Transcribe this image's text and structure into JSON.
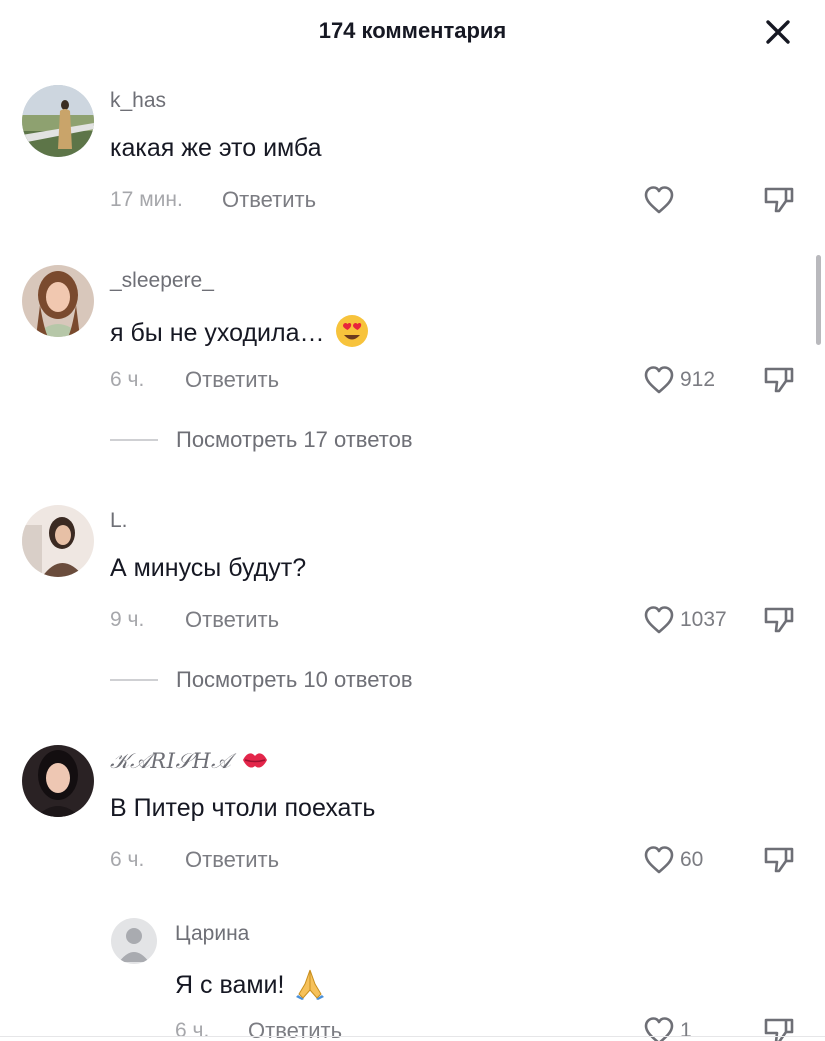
{
  "header": {
    "title": "174 комментария"
  },
  "comments": [
    {
      "username": "k_has",
      "text": "какая же это имба",
      "time": "17 мин.",
      "reply_label": "Ответить",
      "likes": "",
      "avatar_icon": "photo-avatar"
    },
    {
      "username": "_sleepere_",
      "text": "я бы не уходила…",
      "emoji": "heart-eyes-emoji",
      "time": "6 ч.",
      "reply_label": "Ответить",
      "likes": "912",
      "view_replies": "Посмотреть 17 ответов",
      "avatar_icon": "photo-avatar"
    },
    {
      "username": "L.",
      "text": "А минусы будут?",
      "time": "9 ч.",
      "reply_label": "Ответить",
      "likes": "1037",
      "view_replies": "Посмотреть 10 ответов",
      "avatar_icon": "photo-avatar"
    },
    {
      "username": "𝒦𝒜𝑅𝐼𝒮𝐻𝒜",
      "emoji_after_name": "kiss-mark-emoji",
      "text": "В Питер чтоли поехать",
      "time": "6 ч.",
      "reply_label": "Ответить",
      "likes": "60",
      "avatar_icon": "photo-avatar"
    }
  ],
  "reply": {
    "username": "Царина",
    "text": "Я с вами!",
    "emoji": "folded-hands-emoji",
    "time": "6 ч.",
    "reply_label": "Ответить",
    "likes": "1",
    "avatar_icon": "default-user-avatar"
  },
  "colors": {
    "text": "#161823",
    "secondary": "#6e6f76",
    "muted": "#a6a7ab"
  }
}
